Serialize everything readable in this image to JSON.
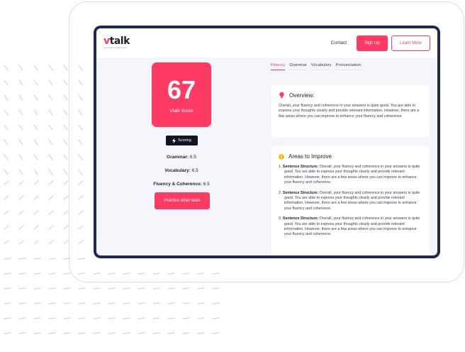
{
  "nav": {
    "logo_v": "v",
    "logo_rest": "talk",
    "logo_tag": "Let's talk engagement",
    "contact": "Contact",
    "signup": "Sign Up",
    "learn_more": "Learn More"
  },
  "score": {
    "value": "67",
    "label": "Vtalk Score",
    "badge": "Scoring"
  },
  "metrics": [
    {
      "label": "Grammar:",
      "value": "6.5"
    },
    {
      "label": "Vocabulary:",
      "value": "6.5"
    },
    {
      "label": "Fluency & Coherence:",
      "value": "6.5"
    }
  ],
  "practice_button": "Practice other tests",
  "tabs": [
    "Fluency",
    "Grammar",
    "Vocabulary",
    "Pronunciation"
  ],
  "overview": {
    "title": "Overview:",
    "text": "Overall, your fluency and coherence in your answers is quite good. You are able to express your thoughts clearly and provide relevant information. However, there are a few areas where you can improve to enhance your fluency and coherence."
  },
  "areas": {
    "title": "Areas to Improve",
    "items": [
      {
        "num": "1.",
        "title": "Sentence Structure:",
        "text": "Overall, your fluency and coherence in your answers is quite good. You are able to express your thoughts clearly and provide relevant information. However, there are a few areas where you can improve to enhance your fluency and coherence."
      },
      {
        "num": "2.",
        "title": "Sentence Structure:",
        "text": "Overall, your fluency and coherence in your answers is quite good. You are able to express your thoughts clearly and provide relevant information. However, there are a few areas where you can improve to enhance your fluency and coherence."
      },
      {
        "num": "3.",
        "title": "Sentence Structure:",
        "text": "Overall, your fluency and coherence in your answers is quite good. You are able to express your thoughts clearly and provide relevant information. However, there are a few areas where you can improve to enhance your fluency and coherence."
      }
    ]
  },
  "colors": {
    "accent": "#ff3a63",
    "device_frame": "#1f2a4a",
    "badge_bg": "#111522",
    "warn": "#f5b400"
  },
  "icons": {
    "bulb": "lightbulb-icon",
    "warn": "warning-icon",
    "bolt": "lightning-icon"
  }
}
